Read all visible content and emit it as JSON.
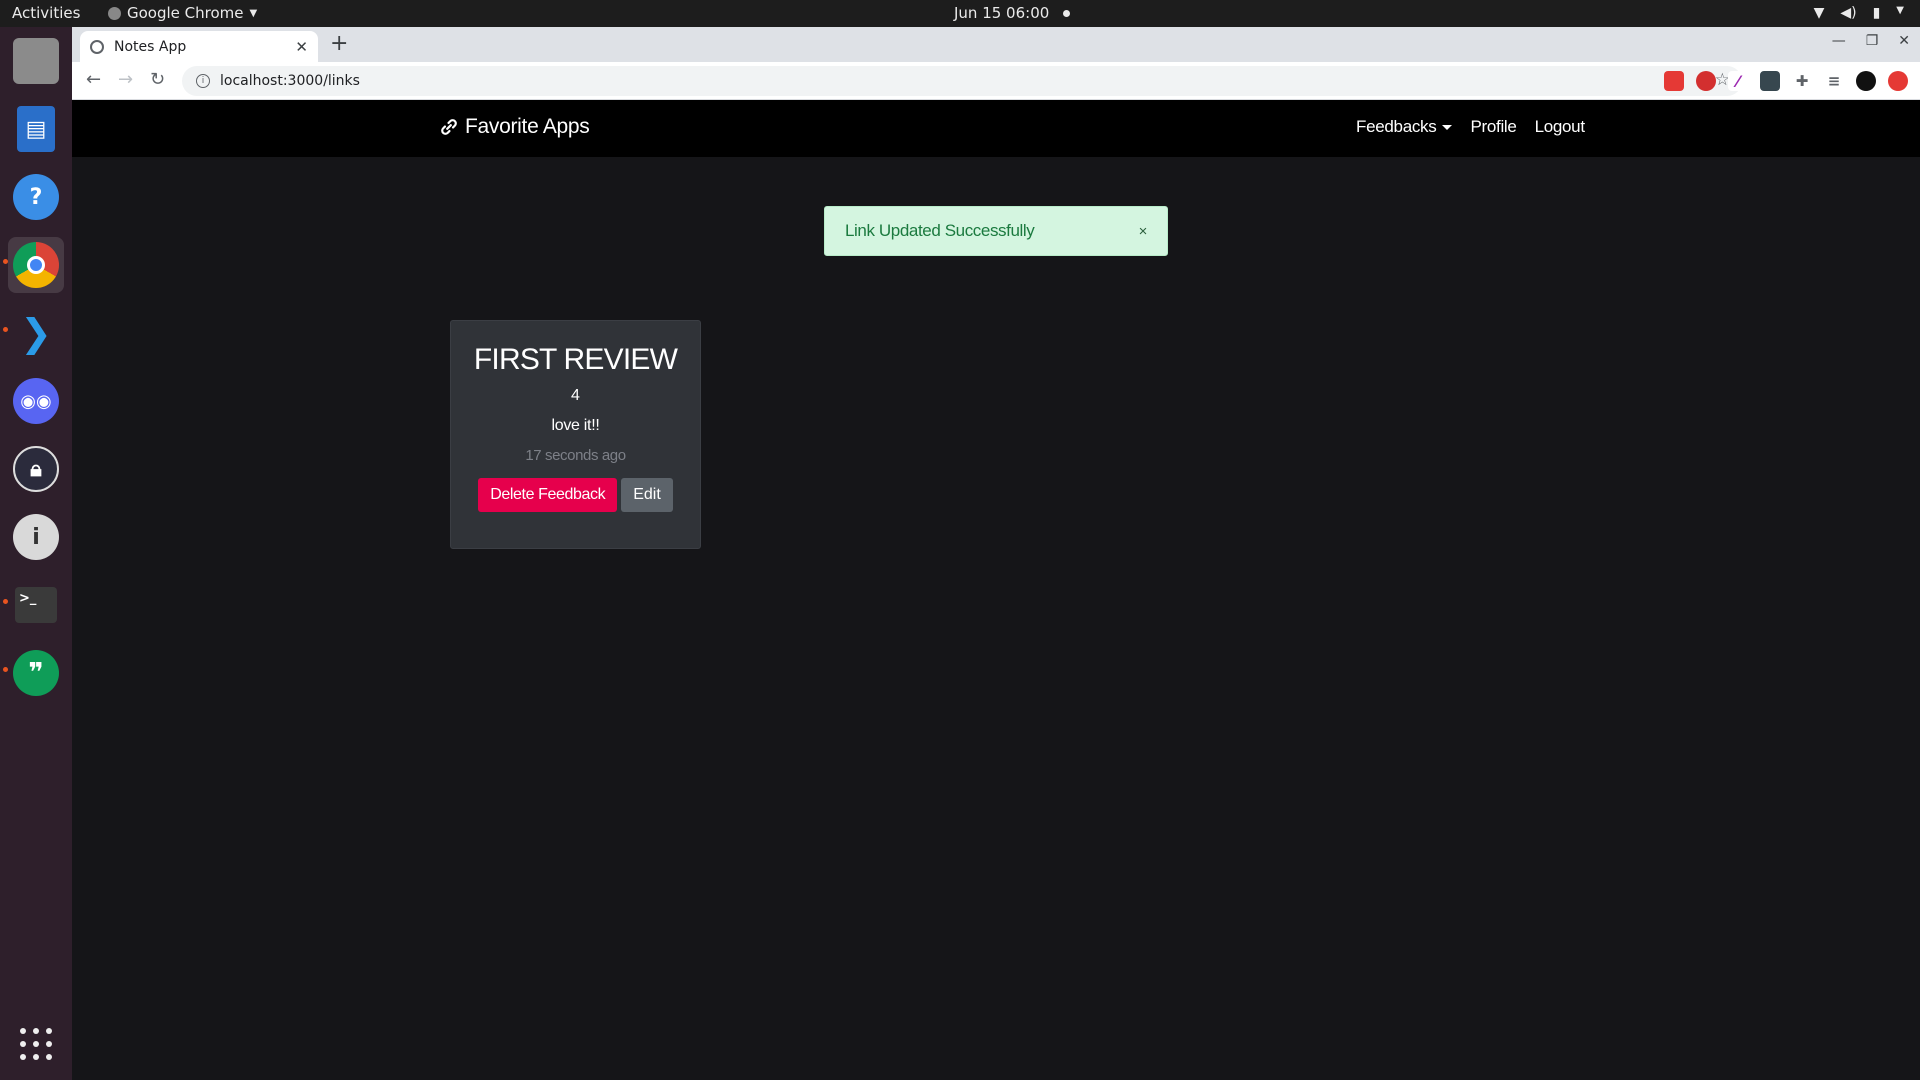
{
  "system": {
    "activities": "Activities",
    "app_menu": "Google Chrome",
    "clock": "Jun 15  06:00"
  },
  "dock": {
    "items": [
      "files-icon",
      "writer-icon",
      "help-icon",
      "chrome-icon",
      "vscode-icon",
      "discord-icon",
      "keepass-icon",
      "onepassword-icon",
      "terminal-icon",
      "hangouts-icon"
    ]
  },
  "browser": {
    "tab_title": "Notes App",
    "url": "localhost:3000/links"
  },
  "navbar": {
    "brand": "Favorite Apps",
    "links": {
      "feedbacks": "Feedbacks",
      "profile": "Profile",
      "logout": "Logout"
    }
  },
  "alert": {
    "message": "Link Updated Successfully",
    "close": "×",
    "color": "#d4f5e0"
  },
  "card": {
    "title": "FIRST REVIEW",
    "rating": "4",
    "description": "love it!!",
    "time": "17 seconds ago",
    "delete_label": "Delete Feedback",
    "edit_label": "Edit",
    "delete_color": "#e6004c"
  }
}
